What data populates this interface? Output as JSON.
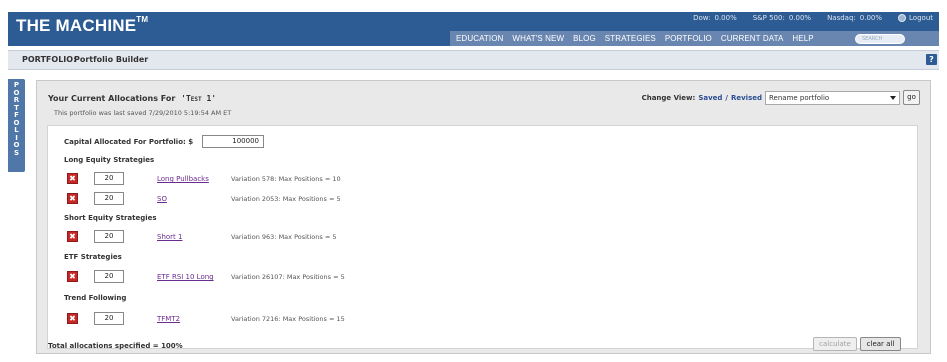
{
  "app": {
    "brand": "THE MACHINE",
    "trademark": "TM"
  },
  "market": {
    "dow_label": "Dow:",
    "dow_value": "0.00%",
    "sp_label": "S&P 500:",
    "sp_value": "0.00%",
    "nasdaq_label": "Nasdaq:",
    "nasdaq_value": "0.00%",
    "logout": "Logout"
  },
  "nav": {
    "items": [
      "EDUCATION",
      "WHAT'S NEW",
      "BLOG",
      "STRATEGIES",
      "PORTFOLIO",
      "CURRENT DATA",
      "HELP"
    ],
    "search_placeholder": "SEARCH"
  },
  "breadcrumb": {
    "section": "PORTFOLIO:",
    "page": "Portfolio Builder"
  },
  "side_tab": {
    "letters": [
      "P",
      "O",
      "R",
      "T",
      "F",
      "O",
      "L",
      "I",
      "O",
      "S"
    ]
  },
  "portfolio": {
    "title_prefix": "Your Current Allocations For",
    "name": "'Test 1'",
    "saved_note": "This portfolio was last saved 7/29/2010 5:19:54 AM ET",
    "change_view_label": "Change View:",
    "saved_link": "Saved",
    "separator": "/",
    "revised_link": "Revised",
    "select_value": "Rename portfolio",
    "go_label": "go",
    "capital_label": "Capital Allocated For Portfolio: $",
    "capital_value": "100000",
    "groups": [
      {
        "heading": "Long Equity Strategies",
        "rows": [
          {
            "alloc": "20",
            "name": "Long Pullbacks",
            "variation": "Variation 578: Max Positions = 10"
          },
          {
            "alloc": "20",
            "name": "SO",
            "variation": "Variation 2053: Max Positions = 5"
          }
        ]
      },
      {
        "heading": "Short Equity Strategies",
        "rows": [
          {
            "alloc": "20",
            "name": "Short 1",
            "variation": "Variation 963: Max Positions = 5"
          }
        ]
      },
      {
        "heading": "ETF Strategies",
        "rows": [
          {
            "alloc": "20",
            "name": "ETF RSI 10 Long",
            "variation": "Variation 26107: Max Positions = 5"
          }
        ]
      },
      {
        "heading": "Trend Following",
        "rows": [
          {
            "alloc": "20",
            "name": "TFMT2",
            "variation": "Variation 7216: Max Positions = 15"
          }
        ]
      }
    ],
    "delete_symbol": "✖",
    "total_note": "Total allocations specified = 100%",
    "calculate_label": "calculate",
    "clear_label": "clear all"
  },
  "colors": {
    "header_bg": "#2d5b93",
    "nav_bg": "#6986b0",
    "link": "#2b4d93",
    "delete": "#c62828"
  }
}
